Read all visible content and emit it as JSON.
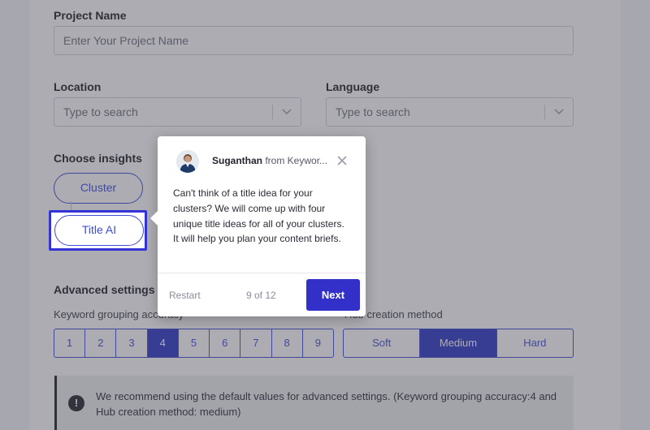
{
  "form": {
    "project_name_label": "Project Name",
    "project_name_placeholder": "Enter Your Project Name",
    "location_label": "Location",
    "location_placeholder": "Type to search",
    "language_label": "Language",
    "language_placeholder": "Type to search",
    "insights_label": "Choose insights",
    "insights": [
      {
        "label": "Cluster"
      },
      {
        "label": "Title AI"
      }
    ]
  },
  "advanced": {
    "title": "Advanced settings",
    "grouping_label": "Keyword grouping accuracy",
    "grouping_options": [
      "1",
      "2",
      "3",
      "4",
      "5",
      "6",
      "7",
      "8",
      "9"
    ],
    "grouping_selected": "4",
    "hub_label": "Hub creation method",
    "hub_options": [
      "Soft",
      "Medium",
      "Hard"
    ],
    "hub_selected": "Medium",
    "notice": "We recommend using the default values for advanced settings. (Keyword grouping accuracy:4 and Hub creation method: medium)",
    "notice_icon": "!"
  },
  "tour": {
    "sender_name": "Suganthan",
    "sender_from": "from Keywor...",
    "message": "Can't think of a title idea for your clusters? We will come up with four unique title ideas for all of your clusters. It will help you plan your content briefs.",
    "restart_label": "Restart",
    "progress": "9 of 12",
    "next_label": "Next"
  },
  "colors": {
    "accent": "#3e4bd6",
    "primary_button": "#3230c8",
    "overlay": "rgba(70,72,84,0.45)"
  }
}
